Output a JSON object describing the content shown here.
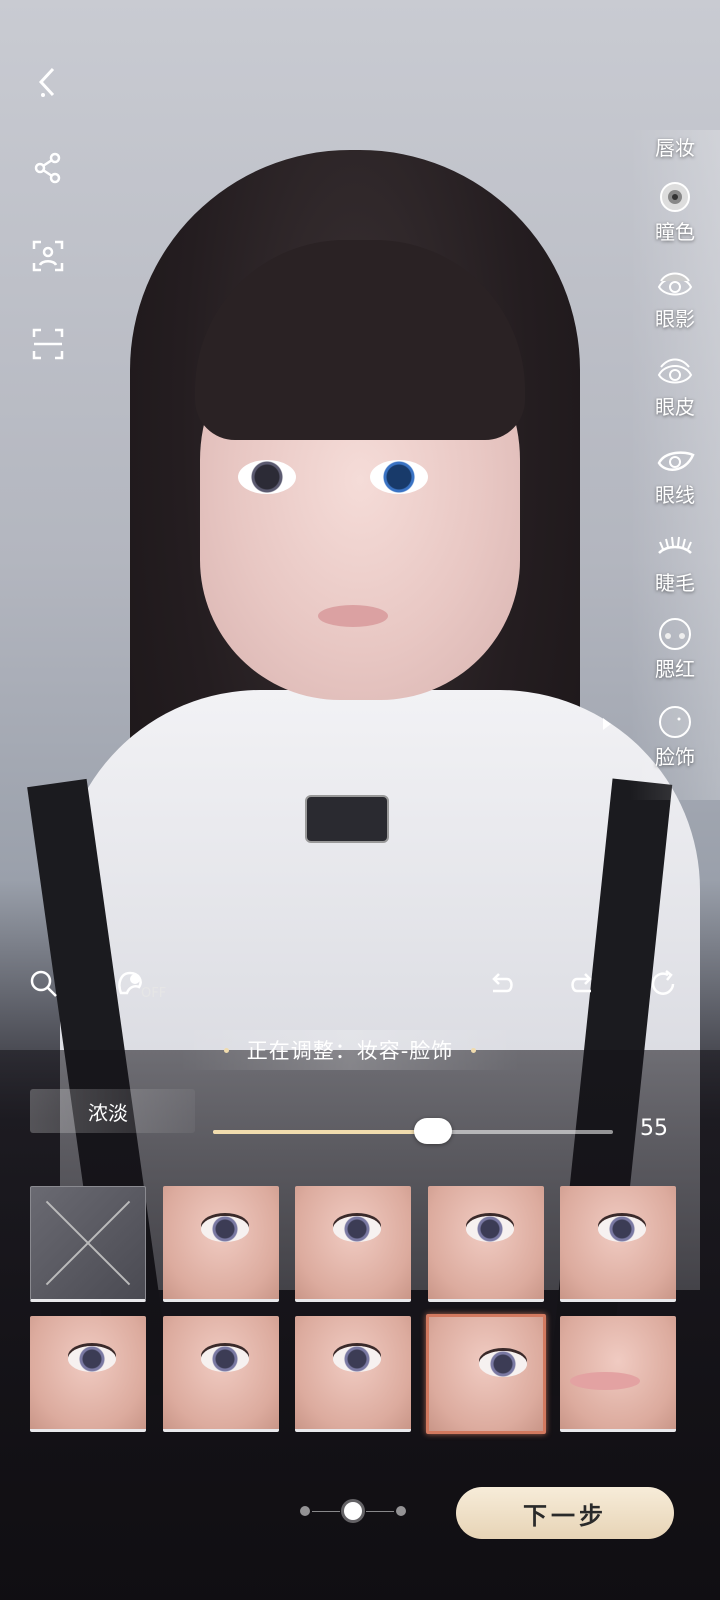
{
  "left_toolbar": {
    "icons": [
      "back-icon",
      "share-icon",
      "face-scan-icon",
      "scan-frame-icon"
    ]
  },
  "categories": [
    {
      "label": "唇妆",
      "icon": "lip-icon"
    },
    {
      "label": "瞳色",
      "icon": "pupil-icon"
    },
    {
      "label": "眼影",
      "icon": "eyeshadow-icon"
    },
    {
      "label": "眼皮",
      "icon": "eyelid-icon"
    },
    {
      "label": "眼线",
      "icon": "eyeliner-icon"
    },
    {
      "label": "睫毛",
      "icon": "eyelash-icon"
    },
    {
      "label": "腮红",
      "icon": "blush-icon"
    },
    {
      "label": "脸饰",
      "icon": "face-decor-icon",
      "selected": true
    }
  ],
  "actions": {
    "hair_toggle_state": "OFF",
    "icons": [
      "search-icon",
      "hair-toggle-icon",
      "undo-icon",
      "redo-icon",
      "reset-icon"
    ]
  },
  "status": {
    "text": "正在调整：妆容-脸饰"
  },
  "slider": {
    "label": "浓淡",
    "value": 55,
    "display_value": "55",
    "max": 100,
    "fill_color": "#f1dcae"
  },
  "thumbnails": {
    "count": 10,
    "selected_index": 8,
    "first_is_none": true,
    "accent_selected": "#d2795f"
  },
  "pager": {
    "pages": 3,
    "active": 1
  },
  "next_button": {
    "label": "下一步"
  }
}
